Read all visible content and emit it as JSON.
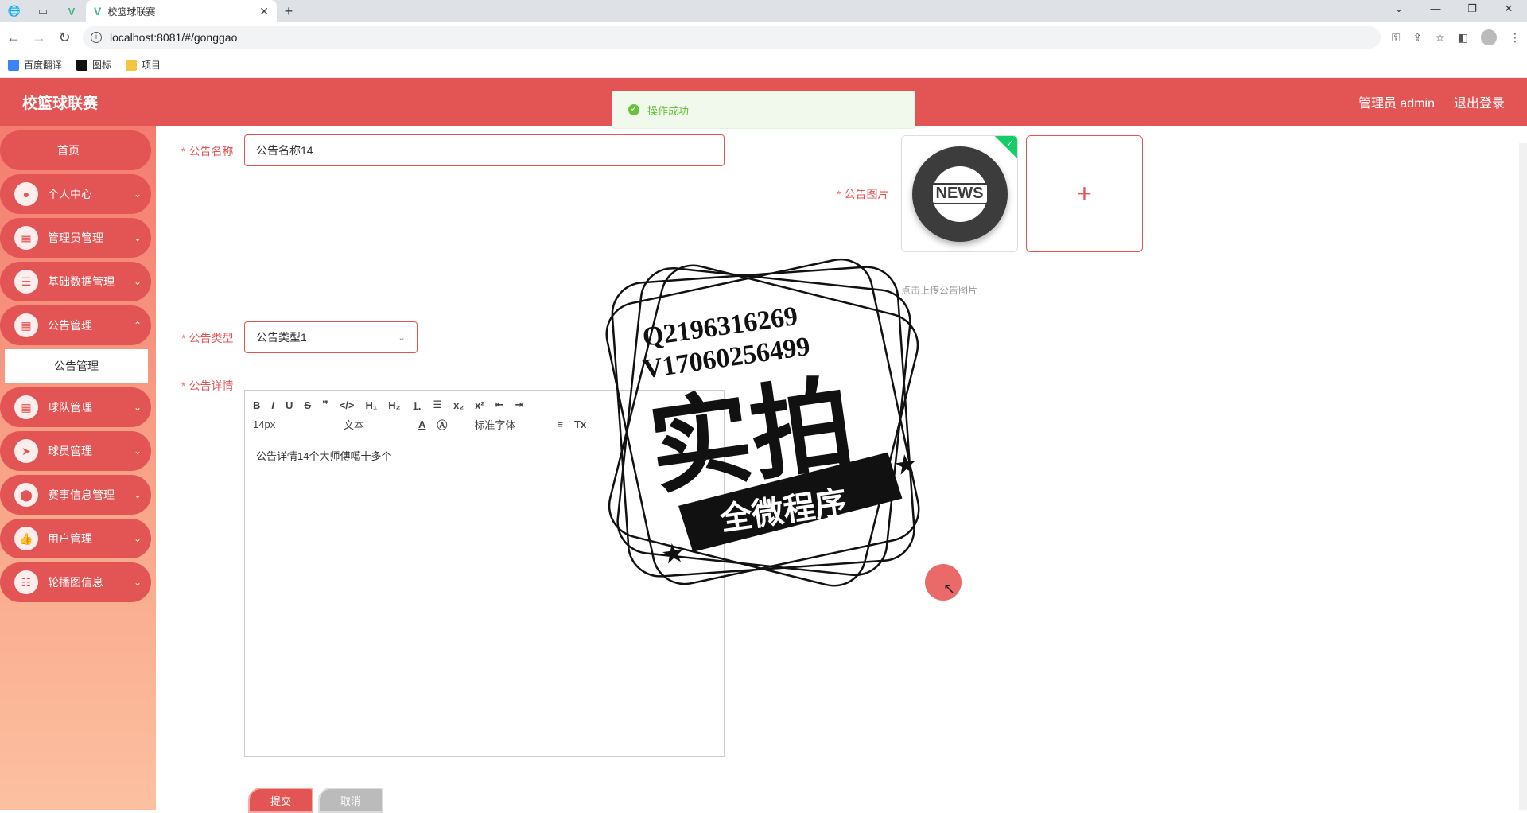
{
  "browser": {
    "tab_title": "校篮球联赛",
    "url": "localhost:8081/#/gonggao",
    "bookmarks": [
      "百度翻译",
      "图标",
      "项目"
    ],
    "window_controls": [
      "⌄",
      "—",
      "❐",
      "✕"
    ]
  },
  "header": {
    "title": "校篮球联赛",
    "user": "管理员 admin",
    "logout": "退出登录"
  },
  "toast": {
    "message": "操作成功",
    "color": "#67c23a"
  },
  "sidebar": {
    "items": [
      {
        "label": "首页",
        "icon": ""
      },
      {
        "label": "个人中心",
        "icon": "user-icon"
      },
      {
        "label": "管理员管理",
        "icon": "grid-icon"
      },
      {
        "label": "基础数据管理",
        "icon": "list-icon"
      },
      {
        "label": "公告管理",
        "icon": "grid-icon"
      },
      {
        "label": "球队管理",
        "icon": "grid-icon"
      },
      {
        "label": "球员管理",
        "icon": "send-icon"
      },
      {
        "label": "赛事信息管理",
        "icon": "location-icon"
      },
      {
        "label": "用户管理",
        "icon": "thumb-icon"
      },
      {
        "label": "轮播图信息",
        "icon": "sliders-icon"
      }
    ],
    "sub_item": "公告管理"
  },
  "form": {
    "name_label": "公告名称",
    "name_value": "公告名称14",
    "image_label": "公告图片",
    "image_badge": "NEWS",
    "upload_tip": "点击上传公告图片",
    "type_label": "公告类型",
    "type_value": "公告类型1",
    "detail_label": "公告详情",
    "editor_font_size": "14px",
    "editor_block": "文本",
    "editor_font": "标准字体",
    "editor_content": "公告详情14个大师傅噶十多个",
    "submit": "提交",
    "cancel": "取消"
  },
  "watermark": {
    "line1": "Q2196316269",
    "line2": "V17060256499",
    "big": "实拍",
    "band": "全微程序"
  },
  "colors": {
    "primary": "#e35454",
    "success": "#13ce66"
  }
}
